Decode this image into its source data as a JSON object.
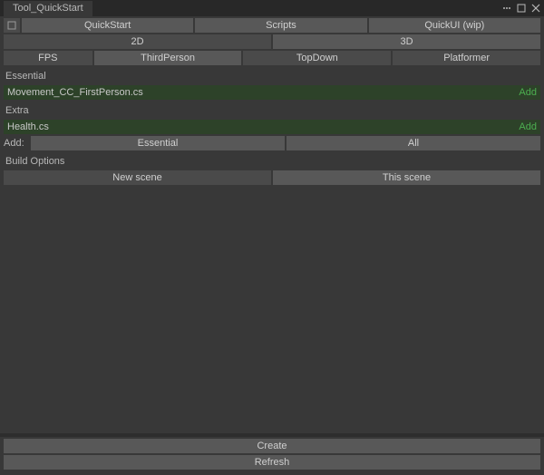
{
  "window": {
    "title": "Tool_QuickStart"
  },
  "topTabs": {
    "t1": "QuickStart",
    "t2": "Scripts",
    "t3": "QuickUI (wip)"
  },
  "dimTabs": {
    "d1": "2D",
    "d2": "3D"
  },
  "genreTabs": {
    "g1": "FPS",
    "g2": "ThirdPerson",
    "g3": "TopDown",
    "g4": "Platformer"
  },
  "sections": {
    "essential": "Essential",
    "extra": "Extra",
    "addLabel": "Add:",
    "buildOptions": "Build Options"
  },
  "items": {
    "movement": "Movement_CC_FirstPerson.cs",
    "health": "Health.cs",
    "addText": "Add"
  },
  "addButtons": {
    "essential": "Essential",
    "all": "All"
  },
  "buildTabs": {
    "newScene": "New scene",
    "thisScene": "This scene"
  },
  "bottom": {
    "create": "Create",
    "refresh": "Refresh"
  }
}
